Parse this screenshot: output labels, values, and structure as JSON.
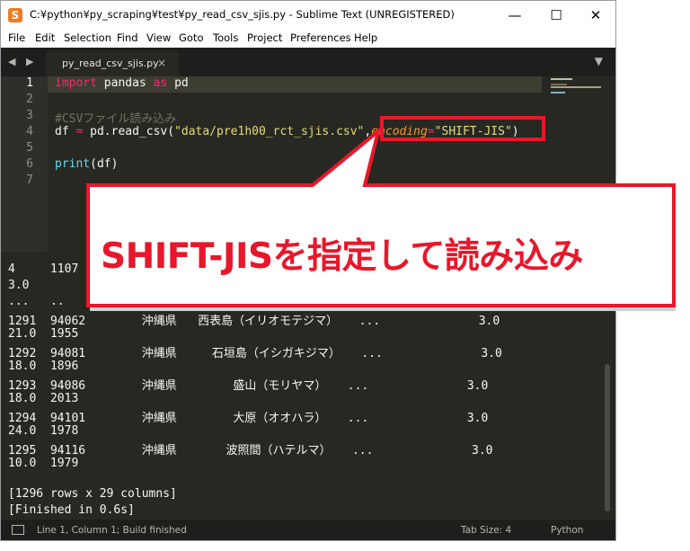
{
  "window": {
    "title": "C:¥python¥py_scraping¥test¥py_read_csv_sjis.py - Sublime Text (UNREGISTERED)",
    "minimize": "—",
    "maximize": "☐",
    "close": "✕"
  },
  "menu": [
    "File",
    "Edit",
    "Selection",
    "Find",
    "View",
    "Goto",
    "Tools",
    "Project",
    "Preferences",
    "Help"
  ],
  "tabbar": {
    "nav": "◀ ▶",
    "tab_label": "py_read_csv_sjis.py",
    "tab_close": "×",
    "dropdown": "▼"
  },
  "editor": {
    "line_numbers": [
      "1",
      "2",
      "3",
      "4",
      "5",
      "6",
      "7"
    ],
    "line1": {
      "kw1": "import",
      "mid": " pandas ",
      "kw2": "as",
      "end": " pd"
    },
    "line3": {
      "comment": "#CSVファイル読み込み"
    },
    "line4": {
      "a": "df ",
      "eq": "=",
      "b": " pd.read_csv(",
      "path": "\"data/pre1h00_rct_sjis.csv\"",
      "comma": ",",
      "param": "encoding",
      "eq2": "=",
      "enc": "\"SHIFT-JIS\"",
      "close": ")"
    },
    "line6": {
      "fn": "print",
      "arg": "(df)"
    }
  },
  "output": {
    "lines": [
      "4     1107",
      "3.0",
      "...   ..",
      "1291  94062        沖縄県   西表島（イリオモテジマ）   ...              3.0",
      "21.0  1955",
      "1292  94081        沖縄県     石垣島（イシガキジマ）   ...              3.0",
      "18.0  1896",
      "1293  94086        沖縄県        盛山（モリヤマ）   ...              3.0",
      "18.0  2013",
      "1294  94101        沖縄県        大原（オオハラ）   ...              3.0",
      "24.0  1978",
      "1295  94116        沖縄県       波照間（ハテルマ）   ...              3.0",
      "10.0  1979",
      "",
      "[1296 rows x 29 columns]",
      "[Finished in 0.6s]"
    ]
  },
  "status": {
    "left": "Line 1, Column 1; Build finished",
    "tab_size": "Tab Size: 4",
    "syntax": "Python"
  },
  "annotation": {
    "callout_text": "SHIFT-JISを指定して読み込み"
  },
  "colors": {
    "accent_red": "#e8172b",
    "editor_bg": "#272822"
  }
}
